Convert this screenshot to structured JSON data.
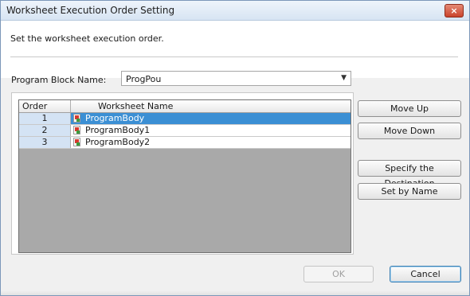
{
  "window": {
    "title": "Worksheet Execution Order Setting",
    "close_icon": "×"
  },
  "instruction": "Set the worksheet execution order.",
  "program_block": {
    "label": "Program Block Name:",
    "value": "ProgPou",
    "dropdown_icon": "▼"
  },
  "grid": {
    "headers": {
      "order": "Order",
      "name": "Worksheet Name"
    },
    "rows": [
      {
        "order": "1",
        "name": "ProgramBody",
        "selected": true
      },
      {
        "order": "2",
        "name": "ProgramBody1",
        "selected": false
      },
      {
        "order": "3",
        "name": "ProgramBody2",
        "selected": false
      }
    ]
  },
  "buttons": {
    "move_up": "Move Up",
    "move_down": "Move Down",
    "specify_destination": "Specify the Destination",
    "set_by_name": "Set by Name",
    "ok": "OK",
    "cancel": "Cancel"
  },
  "colors": {
    "selection": "#3b8fd4",
    "order_cell": "#d4e3f4",
    "grid_background": "#a9a9a9"
  }
}
